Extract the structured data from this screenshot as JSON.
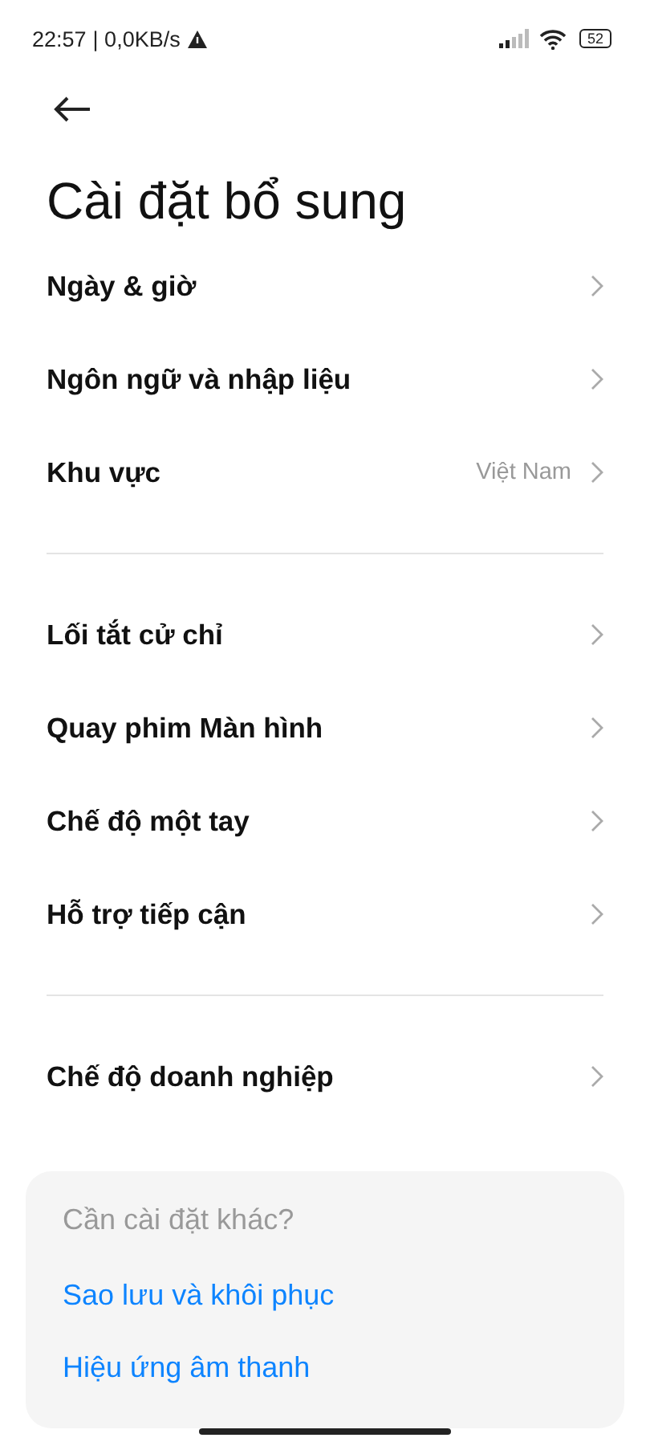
{
  "status_bar": {
    "time": "22:57",
    "speed": "| 0,0KB/s",
    "battery": "52"
  },
  "title": "Cài đặt bổ sung",
  "sections": [
    {
      "items": [
        {
          "label": "Ngày & giờ"
        },
        {
          "label": "Ngôn ngữ và nhập liệu"
        },
        {
          "label": "Khu vực",
          "value": "Việt Nam"
        }
      ]
    },
    {
      "items": [
        {
          "label": "Lối tắt cử chỉ"
        },
        {
          "label": "Quay phim Màn hình"
        },
        {
          "label": "Chế độ một tay"
        },
        {
          "label": "Hỗ trợ tiếp cận"
        }
      ]
    },
    {
      "items": [
        {
          "label": "Chế độ doanh nghiệp"
        }
      ]
    }
  ],
  "suggestions": {
    "title": "Cần cài đặt khác?",
    "links": [
      "Sao lưu và khôi phục",
      "Hiệu ứng âm thanh"
    ]
  }
}
